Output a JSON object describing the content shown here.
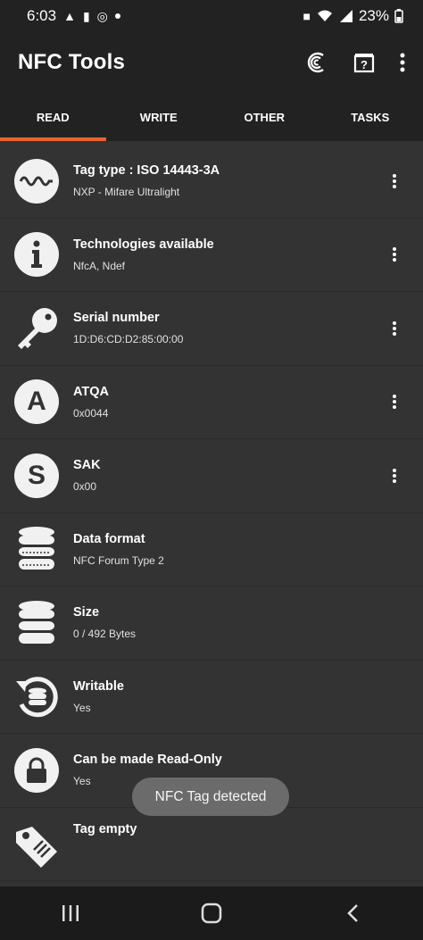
{
  "status_bar": {
    "time": "6:03",
    "battery": "23%"
  },
  "app": {
    "title": "NFC Tools"
  },
  "tabs": [
    {
      "label": "READ",
      "active": true
    },
    {
      "label": "WRITE"
    },
    {
      "label": "OTHER"
    },
    {
      "label": "TASKS"
    }
  ],
  "records": [
    {
      "title": "Tag type : ISO 14443-3A",
      "value": "NXP - Mifare Ultralight",
      "icon": "wave-icon"
    },
    {
      "title": "Technologies available",
      "value": "NfcA, Ndef",
      "icon": "info-icon"
    },
    {
      "title": "Serial number",
      "value": "1D:D6:CD:D2:85:00:00",
      "icon": "key-icon"
    },
    {
      "title": "ATQA",
      "value": "0x0044",
      "icon": "letter-a-icon",
      "glyph": "A"
    },
    {
      "title": "SAK",
      "value": "0x00",
      "icon": "letter-s-icon",
      "glyph": "S"
    },
    {
      "title": "Data format",
      "value": "NFC Forum Type 2",
      "icon": "database-icon"
    },
    {
      "title": "Size",
      "value": "0 / 492 Bytes",
      "icon": "database-icon"
    },
    {
      "title": "Writable",
      "value": "Yes",
      "icon": "refresh-database-icon"
    },
    {
      "title": "Can be made Read-Only",
      "value": "Yes",
      "icon": "lock-icon"
    },
    {
      "title": "Tag empty",
      "value": "",
      "icon": "tag-icon"
    }
  ],
  "toast": {
    "message": "NFC Tag detected"
  },
  "colors": {
    "accent": "#e9632c",
    "background": "#333333",
    "app_bar": "#222222"
  }
}
